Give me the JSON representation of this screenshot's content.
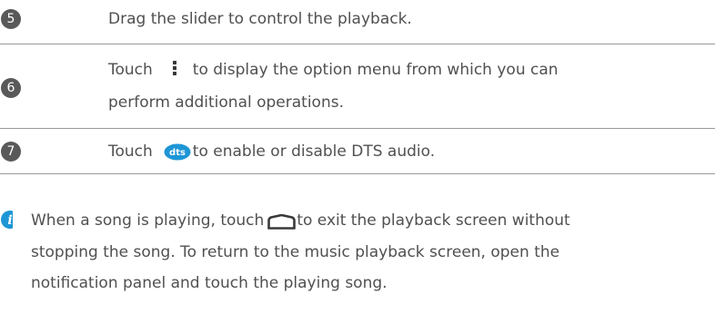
{
  "steps": [
    {
      "number": "5",
      "text": "Drag the slider to control the playback."
    },
    {
      "number": "6",
      "text_before_icon": "Touch",
      "icon": "more-options-icon",
      "text_after_icon": "to display the option menu from which you can",
      "text_line2": "perform additional operations."
    },
    {
      "number": "7",
      "text_before_icon": "Touch",
      "icon": "dts-icon",
      "icon_label": "dts",
      "text_after_icon": "to enable or disable DTS audio."
    }
  ],
  "note": {
    "icon": "info-icon",
    "line1_before_icon": "When a song is playing, touch",
    "line1_icon": "home-icon",
    "line1_after_icon": "to exit the playback screen without",
    "line2": "stopping the song. To return to the music playback screen, open the",
    "line3": "notification panel and touch the playing song."
  },
  "colors": {
    "badge": "#595959",
    "text": "#505050",
    "divider": "#9a9a9a",
    "accent_blue": "#1e96d6"
  }
}
